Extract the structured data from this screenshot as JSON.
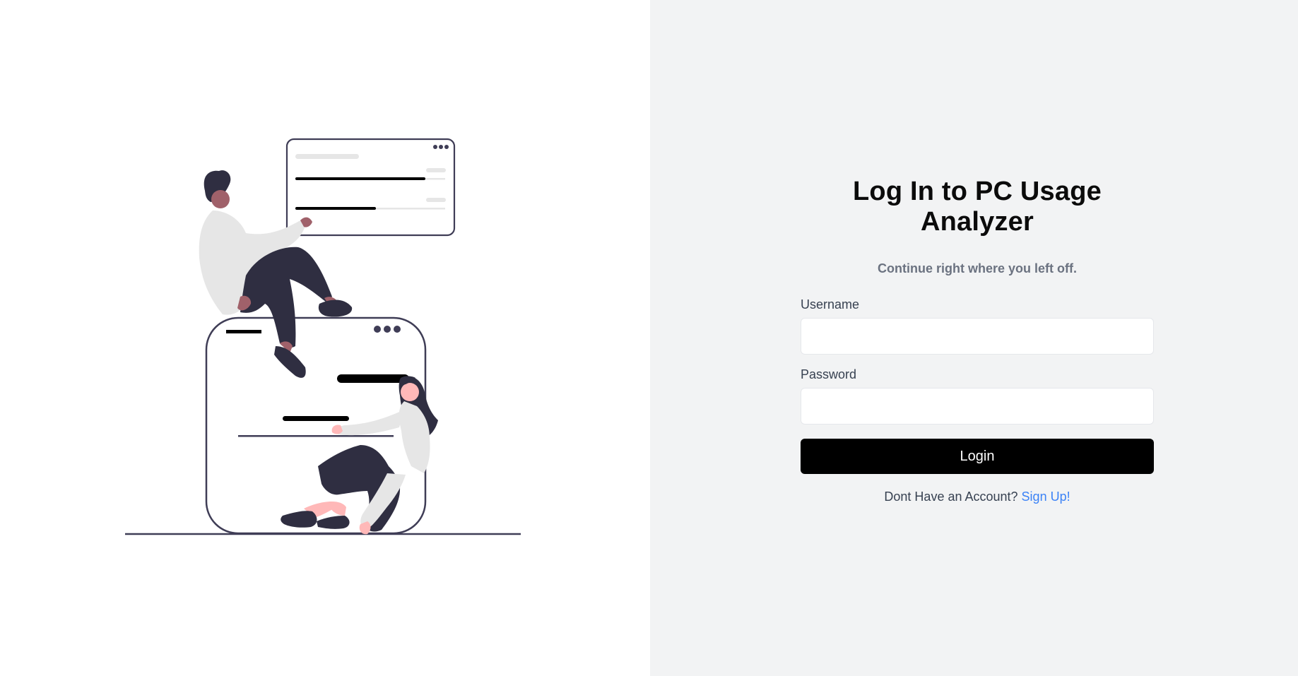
{
  "illustration": {
    "icon": "login-illustration"
  },
  "login": {
    "title": "Log In to PC Usage Analyzer",
    "subtitle": "Continue right where you left off.",
    "username_label": "Username",
    "username_value": "",
    "password_label": "Password",
    "password_value": "",
    "login_label": "Login",
    "signup_prompt": "Dont Have an Account?",
    "signup_link": "Sign Up!"
  },
  "colors": {
    "accent_link": "#3b82f6",
    "button_bg": "#000000",
    "right_pane_bg": "#f2f3f4",
    "left_pane_bg": "#ffffff"
  }
}
